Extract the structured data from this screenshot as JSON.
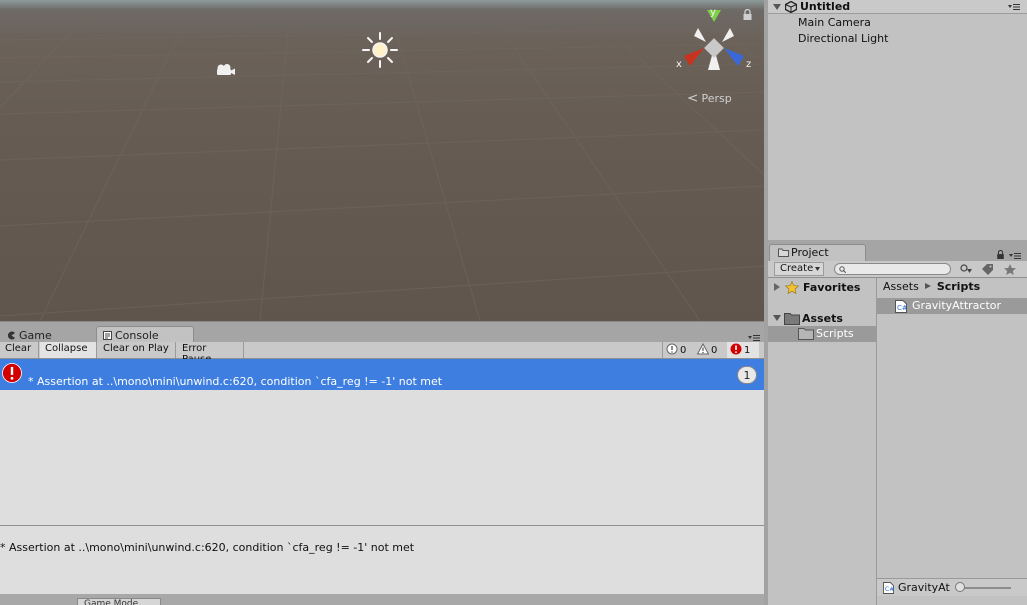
{
  "scene": {
    "persp_label": "Persp",
    "axis_labels": {
      "x": "x",
      "y": "y",
      "z": "z"
    }
  },
  "console": {
    "tabs": [
      {
        "label": "Game",
        "icon": "game-icon"
      },
      {
        "label": "Console",
        "icon": "console-icon"
      }
    ],
    "toolbar": {
      "clear": "Clear",
      "collapse": "Collapse",
      "clear_on_play": "Clear on Play",
      "error_pause": "Error Pause",
      "info_count": "0",
      "warning_count": "0",
      "error_count": "1"
    },
    "log": {
      "message": "* Assertion at ..\\mono\\mini\\unwind.c:620, condition `cfa_reg != -1' not met",
      "count": "1"
    },
    "detail": "* Assertion at ..\\mono\\mini\\unwind.c:620, condition `cfa_reg != -1' not met"
  },
  "hierarchy": {
    "title": "Untitled",
    "items": [
      "Main Camera",
      "Directional Light"
    ]
  },
  "project": {
    "tab_label": "Project",
    "create_label": "Create",
    "tree": [
      {
        "label": "Favorites"
      },
      {
        "label": "Assets"
      },
      {
        "label": "Scripts"
      }
    ],
    "breadcrumb": [
      "Assets",
      "Scripts"
    ],
    "assets": [
      {
        "label": "GravityAttractor"
      }
    ],
    "bottom_label": "GravityAt",
    "bottom_slider_value": 0
  },
  "bottom_tab_label": "Game Mode"
}
